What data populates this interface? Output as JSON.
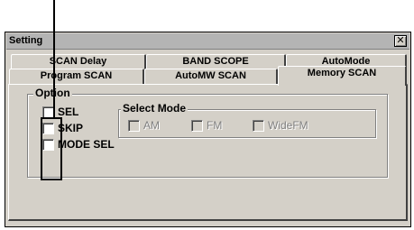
{
  "window": {
    "title": "Setting",
    "close_glyph": "✕"
  },
  "tabs": {
    "row1": [
      "SCAN Delay",
      "BAND SCOPE",
      "AutoMode"
    ],
    "row2": [
      "Program SCAN",
      "AutoMW SCAN",
      "Memory SCAN"
    ],
    "active": "Memory SCAN"
  },
  "option_group": {
    "title": "Option",
    "items": [
      {
        "label": "SEL",
        "checked": false
      },
      {
        "label": "SKIP",
        "checked": false
      },
      {
        "label": "MODE SEL",
        "checked": false
      }
    ]
  },
  "select_mode_group": {
    "title": "Select Mode",
    "enabled": false,
    "items": [
      {
        "label": "AM",
        "checked": false
      },
      {
        "label": "FM",
        "checked": false
      },
      {
        "label": "WideFM",
        "checked": false
      }
    ]
  }
}
